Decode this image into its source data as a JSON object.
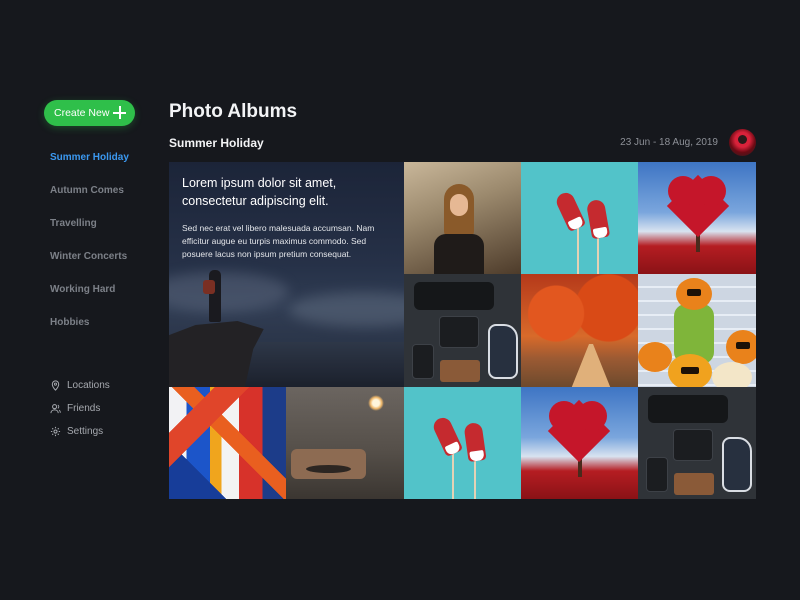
{
  "sidebar": {
    "create_label": "Create New",
    "albums": [
      {
        "label": "Summer Holiday",
        "active": true
      },
      {
        "label": "Autumn Comes",
        "active": false
      },
      {
        "label": "Travelling",
        "active": false
      },
      {
        "label": "Winter Concerts",
        "active": false
      },
      {
        "label": "Working Hard",
        "active": false
      },
      {
        "label": "Hobbies",
        "active": false
      }
    ],
    "links": [
      {
        "label": "Locations",
        "icon": "location-pin-icon"
      },
      {
        "label": "Friends",
        "icon": "friends-icon"
      },
      {
        "label": "Settings",
        "icon": "gear-icon"
      }
    ]
  },
  "header": {
    "page_title": "Photo Albums",
    "album_title": "Summer Holiday",
    "date_range": "23 Jun - 18 Aug, 2019"
  },
  "feature": {
    "heading": "Lorem ipsum dolor sit amet, consectetur adipiscing elit.",
    "body": "Sed nec erat vel libero malesuada accumsan. Nam efficitur augue eu turpis maximus commodo. Sed posuere lacus non ipsum pretium consequat."
  },
  "colors": {
    "accent_green": "#2fbf4a",
    "active_blue": "#3b98f0",
    "background": "#16181d"
  }
}
